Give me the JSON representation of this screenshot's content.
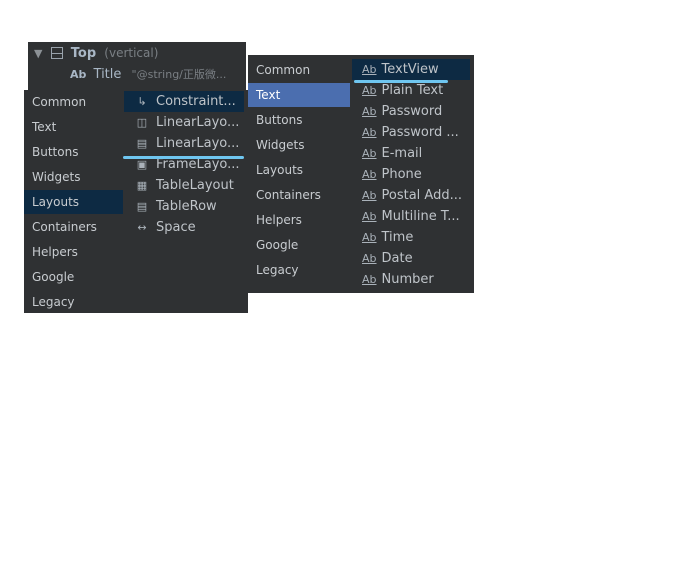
{
  "tree": {
    "top_label": "Top",
    "top_hint": "(vertical)",
    "title_icon": "Ab",
    "title_label": "Title",
    "title_value": "\"@string/正版微..."
  },
  "left_palette": {
    "categories": [
      "Common",
      "Text",
      "Buttons",
      "Widgets",
      "Layouts",
      "Containers",
      "Helpers",
      "Google",
      "Legacy"
    ],
    "selected": "Layouts",
    "items": [
      {
        "icon": "constraint-layout-icon",
        "label": "Constraint..."
      },
      {
        "icon": "linear-layout-vertical-icon",
        "label": "LinearLayo..."
      },
      {
        "icon": "linear-layout-horizontal-icon",
        "label": "LinearLayo..."
      },
      {
        "icon": "frame-layout-icon",
        "label": "FrameLayo..."
      },
      {
        "icon": "table-layout-icon",
        "label": "TableLayout"
      },
      {
        "icon": "table-row-icon",
        "label": "TableRow"
      },
      {
        "icon": "space-icon",
        "label": "Space"
      }
    ]
  },
  "right_palette": {
    "categories": [
      "Common",
      "Text",
      "Buttons",
      "Widgets",
      "Layouts",
      "Containers",
      "Helpers",
      "Google",
      "Legacy"
    ],
    "selected": "Text",
    "ab_icon": "Ab",
    "items": [
      "TextView",
      "Plain Text",
      "Password",
      "Password ...",
      "E-mail",
      "Phone",
      "Postal Add...",
      "Multiline T...",
      "Time",
      "Date",
      "Number"
    ]
  },
  "colors": {
    "panel_bg": "#2f3133",
    "selected_dark": "#0d2a43",
    "selected_blue": "#4b6eaf",
    "drop_indicator": "#6fc6f0"
  }
}
